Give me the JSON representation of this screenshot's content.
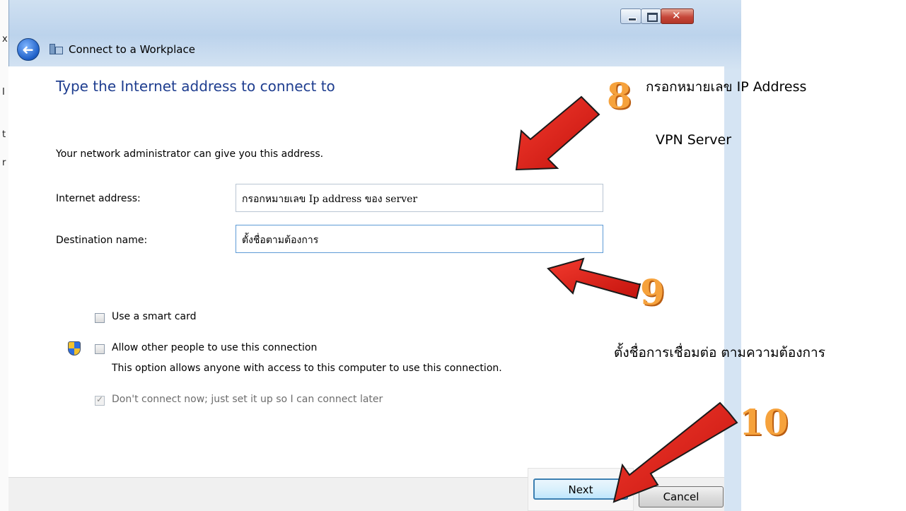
{
  "window": {
    "title": "Connect to a Workplace",
    "controls": {
      "minimize": "minimize",
      "maximize": "maximize",
      "close": "close"
    }
  },
  "background_fragments": [
    "x",
    "I",
    "t",
    "r"
  ],
  "page": {
    "heading": "Type the Internet address to connect to",
    "info": "Your network administrator can give you this address."
  },
  "form": {
    "internet_address_label": "Internet address:",
    "internet_address_value": "กรอกหมายเลข Ip address ของ server",
    "destination_name_label": "Destination name:",
    "destination_name_value": "ตั้งชื่อตามต้องการ"
  },
  "options": {
    "smart_card_label": "Use a smart card",
    "allow_others_label": "Allow other people to use this connection",
    "allow_others_desc": "This option allows anyone with access to this computer to use this connection.",
    "dont_connect_label": "Don't connect now; just set it up so I can connect later"
  },
  "buttons": {
    "next": "Next",
    "cancel": "Cancel"
  },
  "annotations": {
    "step8": "8",
    "step8_note_line1": "กรอกหมายเลข IP Address",
    "step8_note_line2": "VPN Server",
    "step9": "9",
    "step9_note": "ตั้งชื่อการเชื่อมต่อ ตามความต้องการ",
    "step10": "10"
  },
  "colors": {
    "heading": "#1e3d8f",
    "arrow": "#e8221b",
    "step_number": "#f6a23c"
  }
}
